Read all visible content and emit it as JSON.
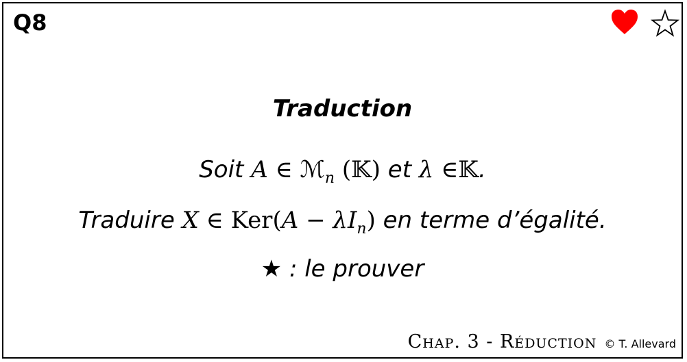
{
  "card": {
    "id": "Q8",
    "title": "Traduction",
    "line1": {
      "w1": "Soit",
      "m1": "A",
      "op1": "∈",
      "m2": "ℳ",
      "m2_sub": "n",
      "m3": "(𝕂)",
      "w2": "et",
      "m4": "λ",
      "op2": "∈",
      "m5": "𝕂",
      "end": "."
    },
    "line2": {
      "w1": "Traduire",
      "m1": "X",
      "op1": "∈",
      "ker": "Ker",
      "open": "(",
      "m2": "A",
      "op2": "−",
      "m3": "λI",
      "m3_sub": "n",
      "close": ")",
      "w2": "en terme d’égalité."
    },
    "line3": {
      "star": "★",
      "text": " : le prouver"
    },
    "footer": {
      "chapter": "Chap. 3 - Réduction",
      "copyright": "© T. Allevard"
    }
  },
  "colors": {
    "heart": "#ff0000",
    "border": "#000000",
    "background": "#ffffff"
  },
  "icons": {
    "favorite": "heart-icon",
    "star": "star-outline-icon"
  }
}
